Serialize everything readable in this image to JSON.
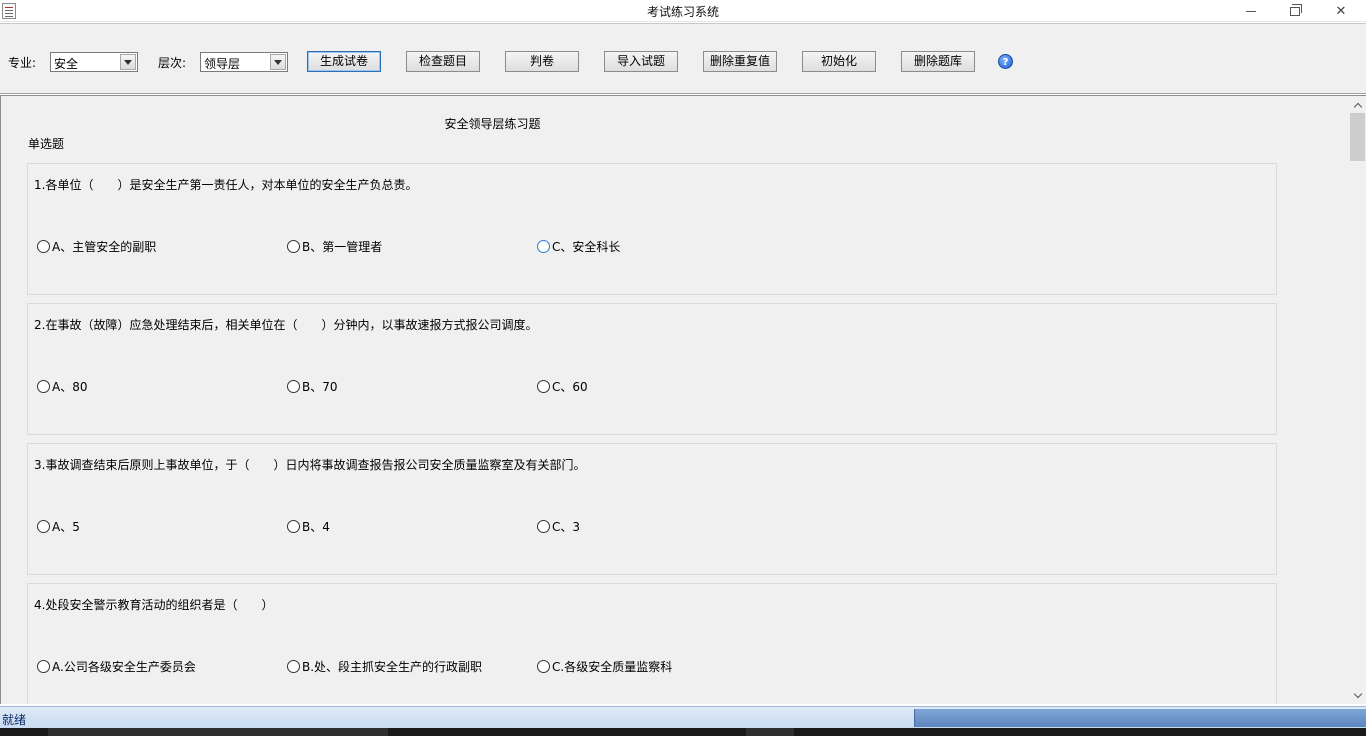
{
  "window": {
    "title": "考试练习系统"
  },
  "toolbar": {
    "major_label": "专业:",
    "major_value": "安全",
    "level_label": "层次:",
    "level_value": "领导层",
    "buttons": {
      "generate": "生成试卷",
      "check": "检查题目",
      "grade": "判卷",
      "import": "导入试题",
      "dedupe": "删除重复值",
      "init": "初始化",
      "delete_bank": "删除题库"
    },
    "help_glyph": "?"
  },
  "paper": {
    "title": "安全领导层练习题",
    "section": "单选题",
    "questions": [
      {
        "text": "1.各单位（　　）是安全生产第一责任人，对本单位的安全生产负总责。",
        "options": [
          "A、主管安全的副职",
          "B、第一管理者",
          "C、安全科长"
        ]
      },
      {
        "text": "2.在事故（故障）应急处理结束后，相关单位在（　　）分钟内，以事故速报方式报公司调度。",
        "options": [
          "A、80",
          "B、70",
          "C、60"
        ]
      },
      {
        "text": "3.事故调查结束后原则上事故单位，于（　　）日内将事故调查报告报公司安全质量监察室及有关部门。",
        "options": [
          "A、5",
          "B、4",
          "C、3"
        ]
      },
      {
        "text": "4.处段安全警示教育活动的组织者是（　　）",
        "options": [
          "A.公司各级安全生产委员会",
          "B.处、段主抓安全生产的行政副职",
          "C.各级安全质量监察科"
        ]
      }
    ]
  },
  "status": {
    "text": "就绪"
  },
  "icons": {
    "app": "document-app-icon",
    "help": "help-icon",
    "minimize": "minimize-icon",
    "maximize": "restore-icon",
    "close": "close-icon"
  },
  "colors": {
    "statusbar": "#c9dcf2",
    "progress": "#5d86bf",
    "help": "#1d5bd0"
  }
}
